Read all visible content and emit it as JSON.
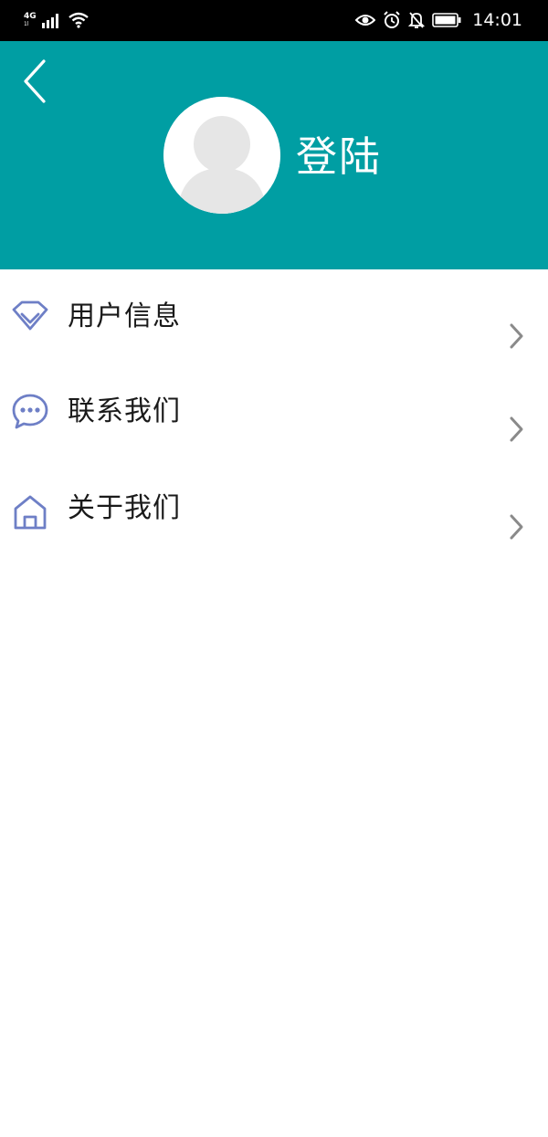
{
  "status_bar": {
    "network": "4G",
    "network_sub": "1l",
    "time": "14:01"
  },
  "header": {
    "login_label": "登陆"
  },
  "menu": {
    "items": [
      {
        "label": "用户信息",
        "icon": "diamond-icon"
      },
      {
        "label": "联系我们",
        "icon": "chat-bubble-icon"
      },
      {
        "label": "关于我们",
        "icon": "home-icon"
      }
    ]
  },
  "colors": {
    "header_bg": "#009ea3",
    "icon_accent": "#6e7fc6",
    "status_bar_bg": "#000000"
  }
}
